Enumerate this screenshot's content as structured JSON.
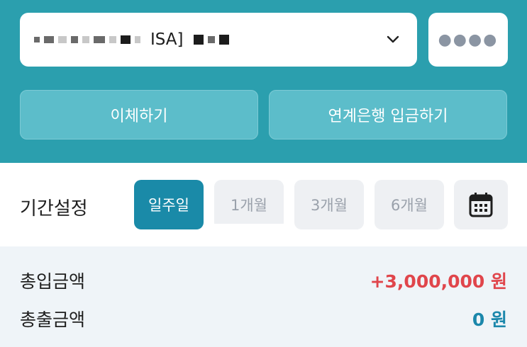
{
  "account": {
    "name_visible": "ISA]",
    "pin_mask": "●●●●"
  },
  "actions": {
    "transfer": "이체하기",
    "linked_deposit": "연계은행 입금하기"
  },
  "period": {
    "label": "기간설정",
    "options": [
      "일주일",
      "1개월",
      "3개월",
      "6개월"
    ],
    "selected": "일주일"
  },
  "summary": {
    "deposit_label": "총입금액",
    "deposit_value": "+3,000,000 원",
    "withdraw_label": "총출금액",
    "withdraw_value": "0 원"
  },
  "colors": {
    "header_bg": "#2b9fae",
    "selected_chip": "#1a8aa8",
    "deposit_color": "#e0454b",
    "withdraw_color": "#1b87ab"
  }
}
